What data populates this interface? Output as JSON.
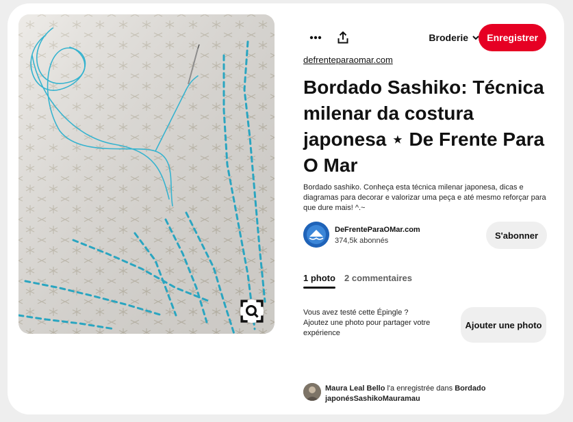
{
  "toolbar": {
    "more_icon": "more-icon",
    "share_icon": "share-icon",
    "board_label": "Broderie",
    "save_label": "Enregistrer",
    "accent": "#e60023"
  },
  "image": {
    "lens_icon": "visual-search-icon"
  },
  "pin": {
    "source": "defrenteparaomar.com",
    "title": "Bordado Sashiko: Técnica milenar da costura japonesa ⋆ De Frente Para O Mar",
    "description": "Bordado sashiko. Conheça esta técnica milenar japonesa, dicas e diagramas para decorar e valorizar uma peça e até mesmo reforçar para que dure mais! ^.~"
  },
  "creator": {
    "name": "DeFrenteParaOMar.com",
    "followers": "374,5k abonnés",
    "follow_label": "S'abonner"
  },
  "tabs": [
    {
      "label": "1 photo"
    },
    {
      "label": "2 commentaires"
    }
  ],
  "tried": {
    "line1": "Vous avez testé cette Épingle ?",
    "line2": "Ajoutez une photo pour partager votre expérience",
    "button": "Ajouter une photo"
  },
  "saved_by": {
    "user": "Maura Leal Bello",
    "middle": " l'a enregistrée dans ",
    "board": "Bordado japonésSashikoMauramau"
  }
}
